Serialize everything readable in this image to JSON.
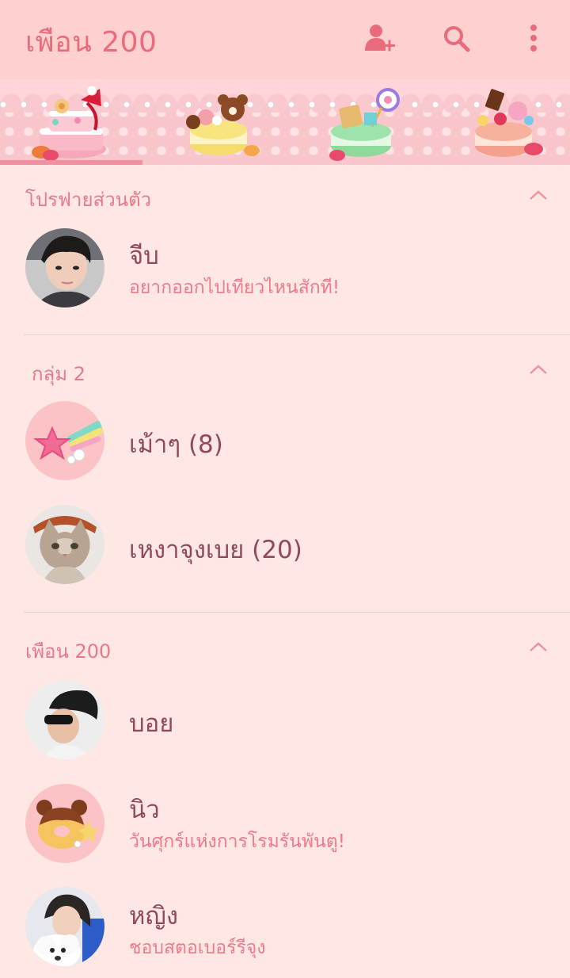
{
  "header": {
    "title": "เพือน 200",
    "icons": [
      "add-friend-icon",
      "search-icon",
      "more-vertical-icon"
    ]
  },
  "colors": {
    "header_bg": "#FFD0D0",
    "page_bg": "#FFE8E4",
    "accent": "#E86C7C",
    "name_text": "#8F4B55",
    "status_text": "#EE7A8C",
    "tab_indicator": "#F28FA0"
  },
  "tabs": [
    {
      "name": "friends-tab",
      "icon": "cake-icon",
      "selected": true
    },
    {
      "name": "chats-tab",
      "icon": "macaron-bear-icon",
      "selected": false
    },
    {
      "name": "timeline-tab",
      "icon": "macaron-lollipop-icon",
      "selected": false
    },
    {
      "name": "more-tab",
      "icon": "macaron-candy-icon",
      "selected": false
    }
  ],
  "sections": {
    "profile": {
      "label": "โปรฟายส่วนตัว",
      "user": {
        "name": "จีบ",
        "status": "อยากออกไปเทียวไหนสักที!"
      }
    },
    "groups": {
      "label": "กลุ่ม 2",
      "items": [
        {
          "name": "เม้าๆ (8)"
        },
        {
          "name": "เหงาจุงเบย (20)"
        }
      ]
    },
    "friends": {
      "label": "เพือน 200",
      "items": [
        {
          "name": "บอย",
          "status": ""
        },
        {
          "name": "นิว",
          "status": "วันศุกร์แห่งการโรมรันพันตู!"
        },
        {
          "name": "หญิง",
          "status": "ชอบสตอเบอร์รีจุง"
        }
      ]
    }
  }
}
